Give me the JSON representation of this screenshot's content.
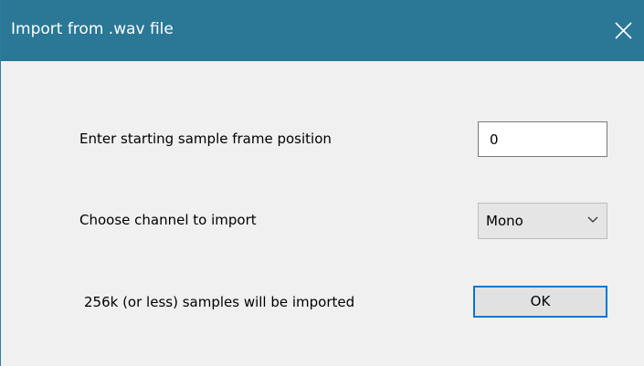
{
  "window": {
    "title": "Import from .wav file",
    "close_icon": "close-icon",
    "titlebar_color": "#2a7896"
  },
  "form": {
    "start_position_label": "Enter starting sample frame position",
    "start_position_value": "0",
    "channel_label": "Choose channel to import",
    "channel_selected": "Mono",
    "info_text": "256k (or less) samples will be imported",
    "ok_label": "OK",
    "ok_border_color": "#0078d7"
  }
}
